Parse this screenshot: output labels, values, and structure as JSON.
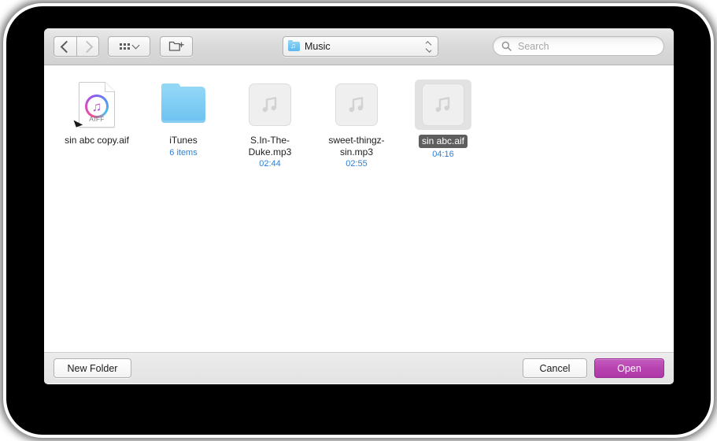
{
  "toolbar": {
    "back_icon": "chevron-left-icon",
    "forward_icon": "chevron-right-icon",
    "view_mode_icon": "icon-view-grid-icon",
    "new_folder_icon": "new-folder-icon",
    "path_label": "Music",
    "path_folder_icon": "music-folder-icon",
    "stepper_icon": "updown-stepper-icon",
    "search_icon": "search-icon",
    "search_placeholder": "Search",
    "search_value": ""
  },
  "files": [
    {
      "name": "sin abc copy.aif",
      "sub": "",
      "icon": "aiff-document-icon",
      "doc_type": "AIFF",
      "selected": false,
      "alias": true
    },
    {
      "name": "iTunes",
      "sub": "6 items",
      "icon": "folder-icon",
      "selected": false,
      "alias": false
    },
    {
      "name": "S.In-The-Duke.mp3",
      "sub": "02:44",
      "icon": "audio-file-icon",
      "selected": false,
      "alias": false
    },
    {
      "name": "sweet-thingz-sin.mp3",
      "sub": "02:55",
      "icon": "audio-file-icon",
      "selected": false,
      "alias": false
    },
    {
      "name": "sin abc.aif",
      "sub": "04:16",
      "icon": "audio-file-icon",
      "selected": true,
      "alias": false
    }
  ],
  "footer": {
    "new_folder_label": "New Folder",
    "cancel_label": "Cancel",
    "open_label": "Open"
  },
  "colors": {
    "accent": "#b743b0",
    "folder_blue": "#76c8f3",
    "subtitle_blue": "#2f7fd6",
    "selection_gray": "#5e5e5e"
  }
}
